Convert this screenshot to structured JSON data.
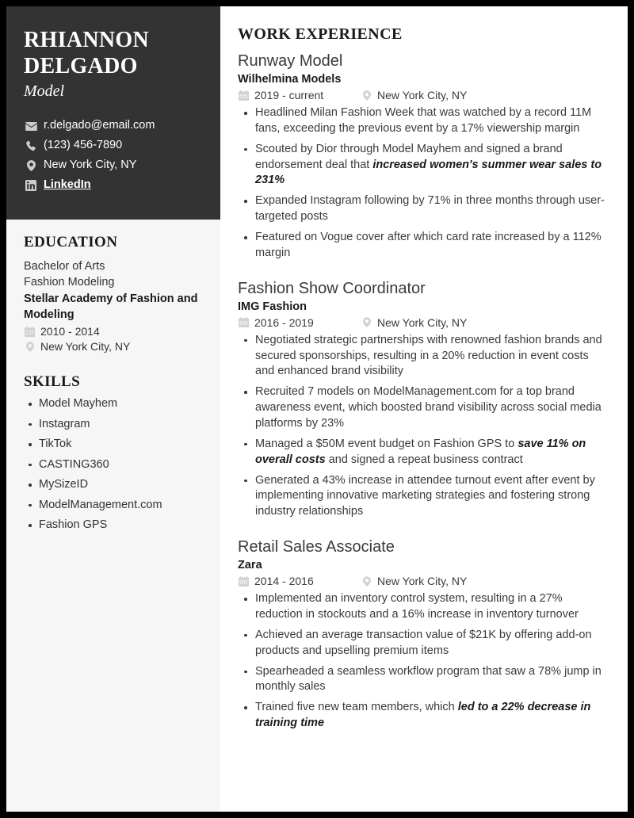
{
  "theme": {
    "page_border": "#000000",
    "sidebar_bg": "#f6f6f6",
    "header_bg": "#333333",
    "text_dark": "#1a1a1a",
    "text_body": "#3a3a3a",
    "icon_muted": "#d2d2d2"
  },
  "sidebar": {
    "name": "RHIANNON DELGADO",
    "name_line1": "RHIANNON",
    "name_line2": "DELGADO",
    "role": "Model",
    "contacts": [
      {
        "icon": "envelope-icon",
        "label": "r.delgado@email.com",
        "is_link": false
      },
      {
        "icon": "phone-icon",
        "label": "(123) 456-7890",
        "is_link": false
      },
      {
        "icon": "location-pin-icon",
        "label": "New York City, NY",
        "is_link": false
      },
      {
        "icon": "linkedin-icon",
        "label": "LinkedIn",
        "is_link": true
      }
    ],
    "education": {
      "heading": "EDUCATION",
      "degree": "Bachelor of Arts",
      "field": "Fashion Modeling",
      "school": "Stellar Academy of Fashion and Modeling",
      "dates": "2010 - 2014",
      "location": "New York City, NY"
    },
    "skills": {
      "heading": "SKILLS",
      "items": [
        "Model Mayhem",
        "Instagram",
        "TikTok",
        "CASTING360",
        "MySizeID",
        "ModelManagement.com",
        "Fashion GPS"
      ]
    }
  },
  "main": {
    "heading": "WORK EXPERIENCE",
    "jobs": [
      {
        "title": "Runway Model",
        "company": "Wilhelmina Models",
        "dates": "2019 - current",
        "location": "New York City, NY",
        "bullets": [
          {
            "pre": "Headlined Milan Fashion Week that was watched by a record 11M fans, exceeding the previous event by a 17% viewership margin",
            "hl": "",
            "post": ""
          },
          {
            "pre": "Scouted by Dior through Model Mayhem and signed a brand endorsement deal that ",
            "hl": "increased women's summer wear sales to 231%",
            "post": ""
          },
          {
            "pre": "Expanded Instagram following by 71% in three months through user-targeted posts",
            "hl": "",
            "post": ""
          },
          {
            "pre": "Featured on Vogue cover after which card rate increased by a 112% margin",
            "hl": "",
            "post": ""
          }
        ]
      },
      {
        "title": "Fashion Show Coordinator",
        "company": "IMG Fashion",
        "dates": "2016 - 2019",
        "location": "New York City, NY",
        "bullets": [
          {
            "pre": "Negotiated strategic partnerships with renowned fashion brands and secured sponsorships, resulting in a 20% reduction in event costs and enhanced brand visibility",
            "hl": "",
            "post": ""
          },
          {
            "pre": "Recruited 7 models on ModelManagement.com for a top brand awareness event, which boosted brand visibility across social media platforms by 23%",
            "hl": "",
            "post": ""
          },
          {
            "pre": "Managed a $50M event budget on Fashion GPS to ",
            "hl": "save 11% on overall costs ",
            "post": "and signed a repeat business contract"
          },
          {
            "pre": "Generated a 43% increase in attendee turnout event after event by implementing innovative marketing strategies and fostering strong industry relationships",
            "hl": "",
            "post": ""
          }
        ]
      },
      {
        "title": "Retail Sales Associate",
        "company": "Zara",
        "dates": "2014 - 2016",
        "location": "New York City, NY",
        "bullets": [
          {
            "pre": "Implemented an inventory control system, resulting in a 27% reduction in stockouts and a 16% increase in inventory turnover",
            "hl": "",
            "post": ""
          },
          {
            "pre": "Achieved an average transaction value of $21K by offering add-on products and upselling premium items",
            "hl": "",
            "post": ""
          },
          {
            "pre": "Spearheaded a seamless workflow program that saw a 78% jump in monthly sales",
            "hl": "",
            "post": ""
          },
          {
            "pre": "Trained five new team members, which ",
            "hl": "led to a 22% decrease in training time",
            "post": ""
          }
        ]
      }
    ]
  }
}
